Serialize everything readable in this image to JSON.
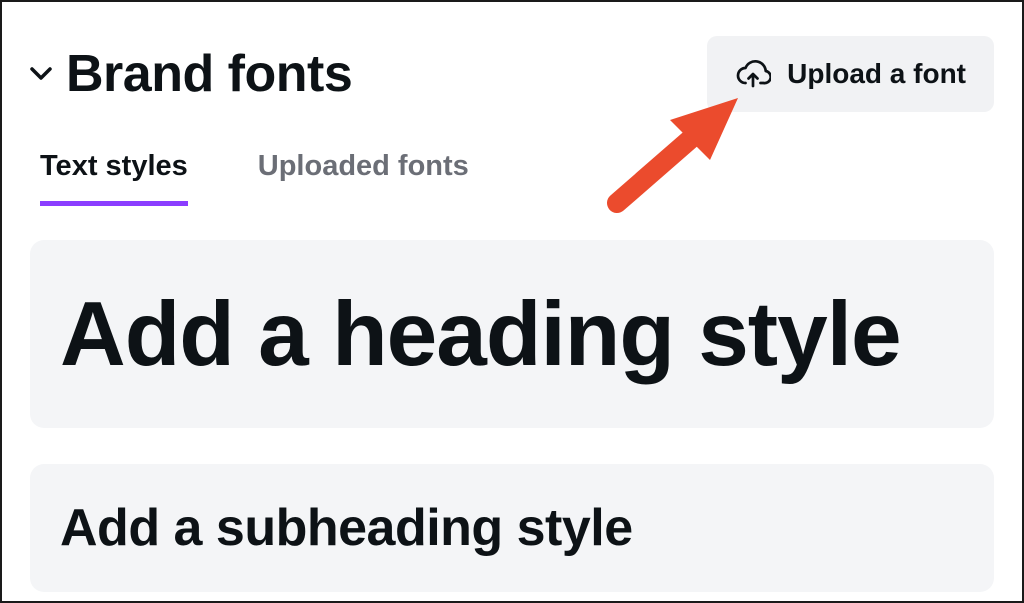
{
  "header": {
    "title": "Brand fonts",
    "upload_button_label": "Upload a font"
  },
  "tabs": {
    "text_styles": "Text styles",
    "uploaded_fonts": "Uploaded fonts"
  },
  "style_cards": {
    "heading": "Add a heading style",
    "subheading": "Add a subheading style"
  },
  "colors": {
    "accent": "#8b3dff",
    "arrow": "#eb4b2d",
    "card_bg": "#f4f5f7",
    "button_bg": "#f1f2f4"
  }
}
